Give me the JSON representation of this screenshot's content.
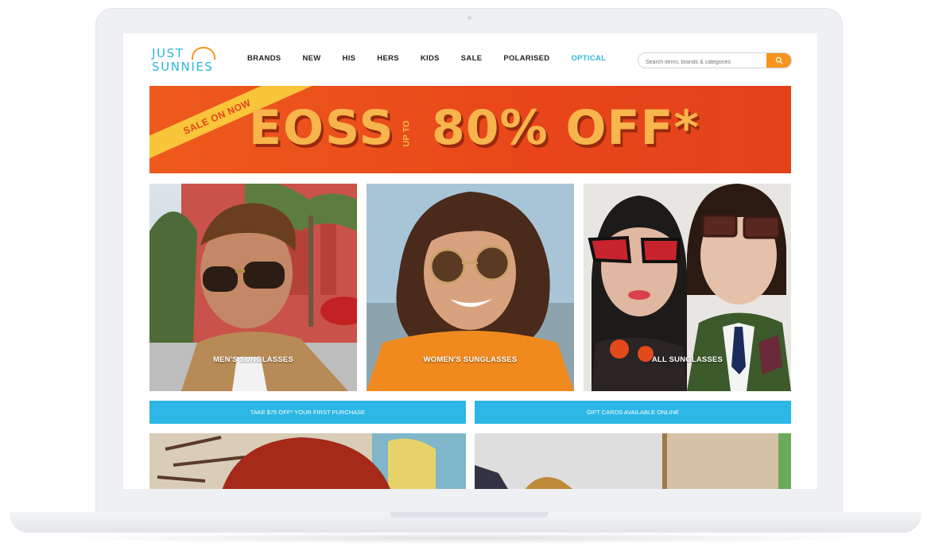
{
  "brand": {
    "line1": "JUST",
    "line2": "SUNNIES"
  },
  "nav": {
    "items": [
      {
        "label": "BRANDS"
      },
      {
        "label": "NEW"
      },
      {
        "label": "HIS"
      },
      {
        "label": "HERS"
      },
      {
        "label": "KIDS"
      },
      {
        "label": "SALE"
      },
      {
        "label": "POLARISED"
      },
      {
        "label": "OPTICAL"
      }
    ]
  },
  "search": {
    "placeholder": "Search items, brands & categories",
    "icon": "search-icon"
  },
  "banner": {
    "ribbon": "SALE ON NOW",
    "headline": "EOSS",
    "upto": "UP TO",
    "offer": "80% OFF*"
  },
  "categories": [
    {
      "label": "MEN'S SUNGLASSES"
    },
    {
      "label": "WOMEN'S SUNGLASSES"
    },
    {
      "label": "ALL SUNGLASSES"
    }
  ],
  "promos": {
    "left": "TAKE $75 OFF* YOUR FIRST PURCHASE",
    "right": "GIFT CARDS AVAILABLE ONLINE"
  },
  "colors": {
    "accent_blue": "#2cb7de",
    "accent_orange": "#f7941d",
    "banner_red": "#e8461a",
    "banner_text": "#f7b54c"
  }
}
